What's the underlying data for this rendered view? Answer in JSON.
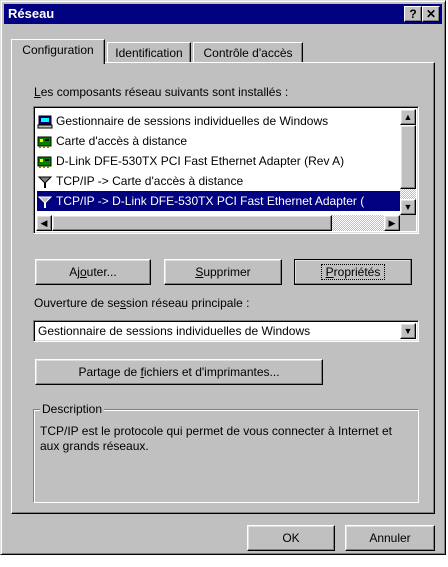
{
  "window": {
    "title": "Réseau",
    "help_label": "?",
    "close_label": "✕"
  },
  "tabs": [
    {
      "label": "Configuration",
      "active": true
    },
    {
      "label": "Identification",
      "active": false
    },
    {
      "label": "Contrôle d'accès",
      "active": false
    }
  ],
  "components": {
    "label_prefix": "L",
    "label_rest": "es composants réseau suivants sont installés :",
    "items": [
      {
        "icon": "client-icon",
        "label": "Gestionnaire de sessions individuelles de Windows",
        "selected": false
      },
      {
        "icon": "adapter-icon",
        "label": "Carte d'accès à distance",
        "selected": false
      },
      {
        "icon": "adapter-icon",
        "label": "D-Link DFE-530TX PCI Fast Ethernet Adapter (Rev A)",
        "selected": false
      },
      {
        "icon": "protocol-icon",
        "label": "TCP/IP -> Carte d'accès à distance",
        "selected": false
      },
      {
        "icon": "protocol-icon",
        "label": "TCP/IP -> D-Link DFE-530TX PCI Fast Ethernet Adapter (",
        "selected": true
      }
    ]
  },
  "buttons": {
    "add_pre": "Aj",
    "add_u": "o",
    "add_post": "uter...",
    "remove_pre": "",
    "remove_u": "S",
    "remove_post": "upprimer",
    "props_pre": "",
    "props_u": "P",
    "props_post": "ropriétés"
  },
  "logon": {
    "label_pre": "Ouverture de se",
    "label_u": "s",
    "label_post": "sion réseau principale :",
    "value": "Gestionnaire de sessions individuelles de Windows"
  },
  "sharing": {
    "pre": "Partage de ",
    "u": "f",
    "post": "ichiers et d'imprimantes..."
  },
  "description": {
    "title": "Description",
    "text": "TCP/IP est le protocole qui permet de vous connecter à Internet et aux grands réseaux."
  },
  "footer": {
    "ok_label": "OK",
    "cancel_label": "Annuler"
  }
}
